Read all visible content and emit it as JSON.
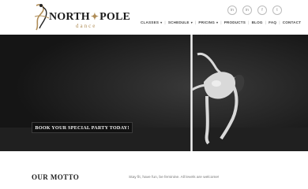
{
  "brand": {
    "name_left": "NORTH",
    "name_right": "POLE",
    "sub": "dance"
  },
  "social": [
    "in",
    "in",
    "f",
    "t"
  ],
  "nav": [
    {
      "label": "CLASSES",
      "caret": true
    },
    {
      "label": "SCHEDULE",
      "caret": true
    },
    {
      "label": "PRICING",
      "caret": true
    },
    {
      "label": "PRODUCTS",
      "caret": false
    },
    {
      "label": "BLOG",
      "caret": false
    },
    {
      "label": "FAQ",
      "caret": false
    },
    {
      "label": "CONTACT",
      "caret": false
    }
  ],
  "hero": {
    "cta_label": "BOOK YOUR SPECIAL PARTY TODAY!"
  },
  "motto": {
    "title": "OUR MOTTO",
    "text": "Stay fit, have fun, be feminine. All levels are welcome!"
  }
}
